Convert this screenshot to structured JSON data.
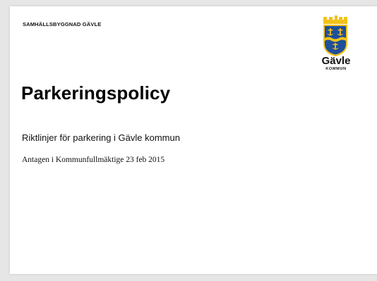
{
  "header": {
    "department": "SAMHÄLLSBYGGNAD GÄVLE"
  },
  "logo": {
    "name": "Gävle",
    "sub": "KOMMUN",
    "icon": "gavle-coat-of-arms-icon",
    "colors": {
      "gold": "#f2c21a",
      "blue": "#1f4f9a",
      "black": "#111111"
    }
  },
  "document": {
    "title": "Parkeringspolicy",
    "subtitle": "Riktlinjer för parkering i Gävle kommun",
    "adopted": "Antagen i Kommunfullmäktige 23 feb 2015"
  }
}
